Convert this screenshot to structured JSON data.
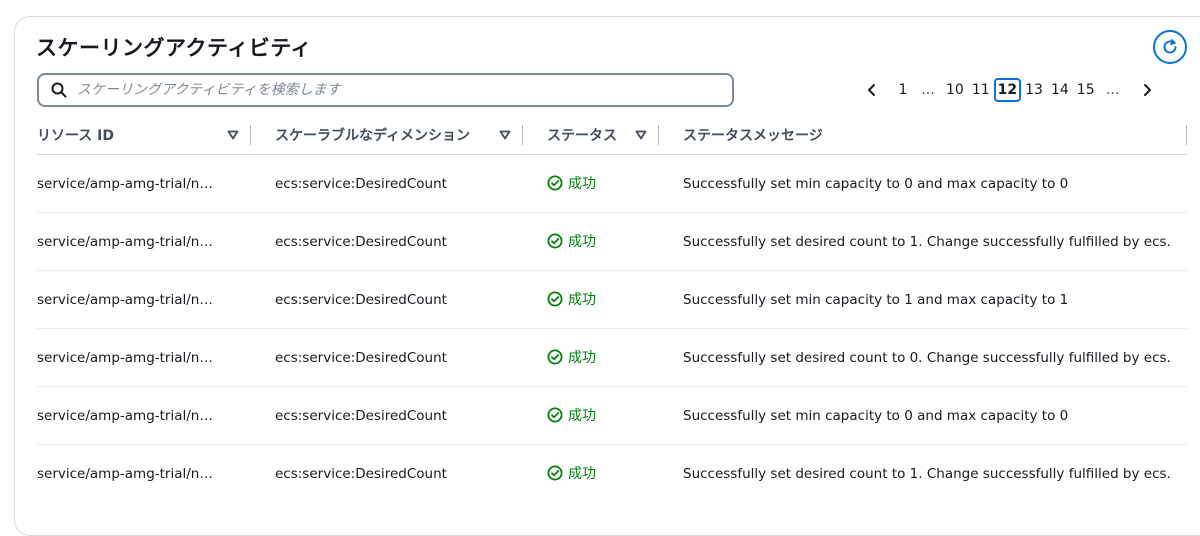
{
  "panel": {
    "title": "スケーリングアクティビティ",
    "refresh_icon": "refresh-icon"
  },
  "search": {
    "placeholder": "スケーリングアクティビティを検索します",
    "value": ""
  },
  "pagination": {
    "prev_icon": "chevron-left-icon",
    "next_icon": "chevron-right-icon",
    "first": "1",
    "ellipsis": "...",
    "pages": [
      "10",
      "11",
      "12",
      "13",
      "14",
      "15"
    ],
    "current": "12"
  },
  "table": {
    "columns": [
      {
        "label": "リソース ID",
        "sortable": true
      },
      {
        "label": "スケーラブルなディメンション",
        "sortable": true
      },
      {
        "label": "ステータス",
        "sortable": true
      },
      {
        "label": "ステータスメッセージ",
        "sortable": false
      }
    ],
    "rows": [
      {
        "resource": "service/amp-amg-trial/n…",
        "dimension": "ecs:service:DesiredCount",
        "status": "成功",
        "message": "Successfully set min capacity to 0 and max capacity to 0"
      },
      {
        "resource": "service/amp-amg-trial/n…",
        "dimension": "ecs:service:DesiredCount",
        "status": "成功",
        "message": "Successfully set desired count to 1. Change successfully fulfilled by ecs."
      },
      {
        "resource": "service/amp-amg-trial/n…",
        "dimension": "ecs:service:DesiredCount",
        "status": "成功",
        "message": "Successfully set min capacity to 1 and max capacity to 1"
      },
      {
        "resource": "service/amp-amg-trial/n…",
        "dimension": "ecs:service:DesiredCount",
        "status": "成功",
        "message": "Successfully set desired count to 0. Change successfully fulfilled by ecs."
      },
      {
        "resource": "service/amp-amg-trial/n…",
        "dimension": "ecs:service:DesiredCount",
        "status": "成功",
        "message": "Successfully set min capacity to 0 and max capacity to 0"
      },
      {
        "resource": "service/amp-amg-trial/n…",
        "dimension": "ecs:service:DesiredCount",
        "status": "成功",
        "message": "Successfully set desired count to 1. Change successfully fulfilled by ecs."
      }
    ]
  },
  "colors": {
    "accent": "#0972d3",
    "success": "#037f0c",
    "border": "#d5dbdb"
  }
}
